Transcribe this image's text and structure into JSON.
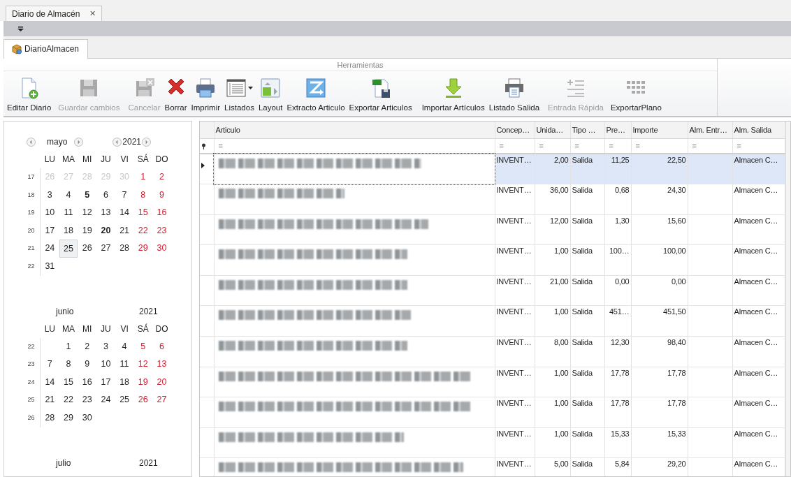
{
  "document_tabs": [
    {
      "label": "Diario de Almacén",
      "close": "✕",
      "selected": true
    }
  ],
  "ribbon": {
    "page_tab": {
      "label": "DiarioAlmacen",
      "selected": true
    },
    "group": "Herramientas",
    "buttons": [
      {
        "label": "Editar Diario",
        "disabled": false,
        "dropdown": false
      },
      {
        "label": "Guardar cambios",
        "disabled": true,
        "dropdown": false
      },
      {
        "label": "Cancelar",
        "disabled": true,
        "dropdown": false
      },
      {
        "label": "Borrar",
        "disabled": false,
        "dropdown": false
      },
      {
        "label": "Imprimir",
        "disabled": false,
        "dropdown": false
      },
      {
        "label": "Listados",
        "disabled": false,
        "dropdown": true
      },
      {
        "label": "Layout",
        "disabled": false,
        "dropdown": false
      },
      {
        "label": "Extracto Articulo",
        "disabled": false,
        "dropdown": false
      },
      {
        "label": "Exportar Articulos",
        "disabled": false,
        "dropdown": false
      },
      {
        "label": "Importar Artículos",
        "disabled": false,
        "dropdown": false
      },
      {
        "label": "Listado Salida",
        "disabled": false,
        "dropdown": false
      },
      {
        "label": "Entrada Rápida",
        "disabled": true,
        "dropdown": false
      },
      {
        "label": "ExportarPlano",
        "disabled": false,
        "dropdown": false
      }
    ]
  },
  "calendar": {
    "months": [
      {
        "month": "mayo",
        "year": "2021",
        "nav": true,
        "weekdays": [
          "LU",
          "MA",
          "MI",
          "JU",
          "VI",
          "SÁ",
          "DO"
        ],
        "weeks": [
          {
            "week": "17",
            "days": [
              {
                "day": "26",
                "kind": "other"
              },
              {
                "day": "27",
                "kind": "other"
              },
              {
                "day": "28",
                "kind": "other"
              },
              {
                "day": "29",
                "kind": "other"
              },
              {
                "day": "30",
                "kind": "other"
              },
              {
                "day": "1",
                "kind": "weekend"
              },
              {
                "day": "2",
                "kind": "weekend"
              }
            ]
          },
          {
            "week": "18",
            "days": [
              {
                "day": "3",
                "kind": "work"
              },
              {
                "day": "4",
                "kind": "work"
              },
              {
                "day": "5",
                "kind": "bold"
              },
              {
                "day": "6",
                "kind": "work"
              },
              {
                "day": "7",
                "kind": "work"
              },
              {
                "day": "8",
                "kind": "weekend"
              },
              {
                "day": "9",
                "kind": "weekend"
              }
            ]
          },
          {
            "week": "19",
            "days": [
              {
                "day": "10",
                "kind": "work"
              },
              {
                "day": "11",
                "kind": "work"
              },
              {
                "day": "12",
                "kind": "work"
              },
              {
                "day": "13",
                "kind": "work"
              },
              {
                "day": "14",
                "kind": "work"
              },
              {
                "day": "15",
                "kind": "weekend"
              },
              {
                "day": "16",
                "kind": "weekend"
              }
            ]
          },
          {
            "week": "20",
            "days": [
              {
                "day": "17",
                "kind": "work"
              },
              {
                "day": "18",
                "kind": "work"
              },
              {
                "day": "19",
                "kind": "work"
              },
              {
                "day": "20",
                "kind": "bold"
              },
              {
                "day": "21",
                "kind": "work"
              },
              {
                "day": "22",
                "kind": "weekend"
              },
              {
                "day": "23",
                "kind": "weekend"
              }
            ]
          },
          {
            "week": "21",
            "days": [
              {
                "day": "24",
                "kind": "work"
              },
              {
                "day": "25",
                "kind": "selected"
              },
              {
                "day": "26",
                "kind": "work"
              },
              {
                "day": "27",
                "kind": "work"
              },
              {
                "day": "28",
                "kind": "work"
              },
              {
                "day": "29",
                "kind": "weekend"
              },
              {
                "day": "30",
                "kind": "weekend"
              }
            ]
          },
          {
            "week": "22",
            "days": [
              {
                "day": "31",
                "kind": "work"
              }
            ]
          }
        ]
      },
      {
        "month": "junio",
        "year": "2021",
        "nav": false,
        "weekdays": [
          "LU",
          "MA",
          "MI",
          "JU",
          "VI",
          "SÁ",
          "DO"
        ],
        "weeks": [
          {
            "week": "22",
            "starts_midweek": true,
            "days": [
              {
                "day": "1",
                "kind": "work"
              },
              {
                "day": "2",
                "kind": "work"
              },
              {
                "day": "3",
                "kind": "work"
              },
              {
                "day": "4",
                "kind": "work"
              },
              {
                "day": "5",
                "kind": "weekend"
              },
              {
                "day": "6",
                "kind": "weekend"
              }
            ]
          },
          {
            "week": "23",
            "days": [
              {
                "day": "7",
                "kind": "work"
              },
              {
                "day": "8",
                "kind": "work"
              },
              {
                "day": "9",
                "kind": "work"
              },
              {
                "day": "10",
                "kind": "work"
              },
              {
                "day": "11",
                "kind": "work"
              },
              {
                "day": "12",
                "kind": "weekend"
              },
              {
                "day": "13",
                "kind": "weekend"
              }
            ]
          },
          {
            "week": "24",
            "days": [
              {
                "day": "14",
                "kind": "work"
              },
              {
                "day": "15",
                "kind": "work"
              },
              {
                "day": "16",
                "kind": "work"
              },
              {
                "day": "17",
                "kind": "work"
              },
              {
                "day": "18",
                "kind": "work"
              },
              {
                "day": "19",
                "kind": "weekend"
              },
              {
                "day": "20",
                "kind": "weekend"
              }
            ]
          },
          {
            "week": "25",
            "days": [
              {
                "day": "21",
                "kind": "work"
              },
              {
                "day": "22",
                "kind": "work"
              },
              {
                "day": "23",
                "kind": "work"
              },
              {
                "day": "24",
                "kind": "work"
              },
              {
                "day": "25",
                "kind": "work"
              },
              {
                "day": "26",
                "kind": "weekend"
              },
              {
                "day": "27",
                "kind": "weekend"
              }
            ]
          },
          {
            "week": "26",
            "days": [
              {
                "day": "28",
                "kind": "work"
              },
              {
                "day": "29",
                "kind": "work"
              },
              {
                "day": "30",
                "kind": "work"
              }
            ]
          }
        ]
      },
      {
        "month": "julio",
        "year": "2021",
        "nav": false
      }
    ]
  },
  "grid": {
    "columns": [
      {
        "label": "Articulo",
        "filter": "="
      },
      {
        "label": "Concep…",
        "filter": "="
      },
      {
        "label": "Unida…",
        "filter": "="
      },
      {
        "label": "Tipo …",
        "filter": "="
      },
      {
        "label": "Pre…",
        "filter": "="
      },
      {
        "label": "Importe",
        "filter": "="
      },
      {
        "label": "Alm. Entr…",
        "filter": "="
      },
      {
        "label": "Alm. Salida",
        "filter": "="
      }
    ],
    "rows": [
      {
        "selected": true,
        "concepto": "INVENT…",
        "unidades": "2,00",
        "tipo": "Salida",
        "precio": "11,25",
        "importe": "22,50",
        "alm_salida": "Almacen C…"
      },
      {
        "selected": false,
        "concepto": "INVENT…",
        "unidades": "36,00",
        "tipo": "Salida",
        "precio": "0,68",
        "importe": "24,30",
        "alm_salida": "Almacen C…"
      },
      {
        "selected": false,
        "concepto": "INVENT…",
        "unidades": "12,00",
        "tipo": "Salida",
        "precio": "1,30",
        "importe": "15,60",
        "alm_salida": "Almacen C…"
      },
      {
        "selected": false,
        "concepto": "INVENT…",
        "unidades": "1,00",
        "tipo": "Salida",
        "precio": "100…",
        "importe": "100,00",
        "alm_salida": "Almacen C…"
      },
      {
        "selected": false,
        "concepto": "INVENT…",
        "unidades": "21,00",
        "tipo": "Salida",
        "precio": "0,00",
        "importe": "0,00",
        "alm_salida": "Almacen C…"
      },
      {
        "selected": false,
        "concepto": "INVENT…",
        "unidades": "1,00",
        "tipo": "Salida",
        "precio": "451…",
        "importe": "451,50",
        "alm_salida": "Almacen C…"
      },
      {
        "selected": false,
        "concepto": "INVENT…",
        "unidades": "8,00",
        "tipo": "Salida",
        "precio": "12,30",
        "importe": "98,40",
        "alm_salida": "Almacen C…"
      },
      {
        "selected": false,
        "concepto": "INVENT…",
        "unidades": "1,00",
        "tipo": "Salida",
        "precio": "17,78",
        "importe": "17,78",
        "alm_salida": "Almacen C…"
      },
      {
        "selected": false,
        "concepto": "INVENT…",
        "unidades": "1,00",
        "tipo": "Salida",
        "precio": "17,78",
        "importe": "17,78",
        "alm_salida": "Almacen C…"
      },
      {
        "selected": false,
        "concepto": "INVENT…",
        "unidades": "1,00",
        "tipo": "Salida",
        "precio": "15,33",
        "importe": "15,33",
        "alm_salida": "Almacen C…"
      },
      {
        "selected": false,
        "concepto": "INVENT…",
        "unidades": "5,00",
        "tipo": "Salida",
        "precio": "5,84",
        "importe": "29,20",
        "alm_salida": "Almacen C…"
      }
    ]
  }
}
